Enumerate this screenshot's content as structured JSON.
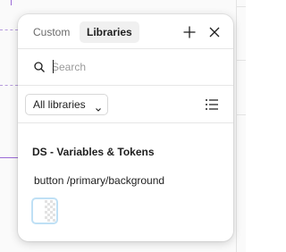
{
  "tabs": [
    {
      "label": "Custom",
      "active": false
    },
    {
      "label": "Libraries",
      "active": true
    }
  ],
  "header": {
    "add_icon": "plus-icon",
    "close_icon": "close-icon"
  },
  "search": {
    "placeholder": "Search",
    "value": ""
  },
  "filter": {
    "selected": "All libraries",
    "list_view_icon": "list-view-icon"
  },
  "library": {
    "title": "DS - Variables & Tokens",
    "variables": [
      {
        "name": "button /primary/background",
        "swatch": "transparent"
      }
    ]
  },
  "colors": {
    "accent": "#9b6bd6",
    "swatch_border": "#bfe0f5"
  }
}
